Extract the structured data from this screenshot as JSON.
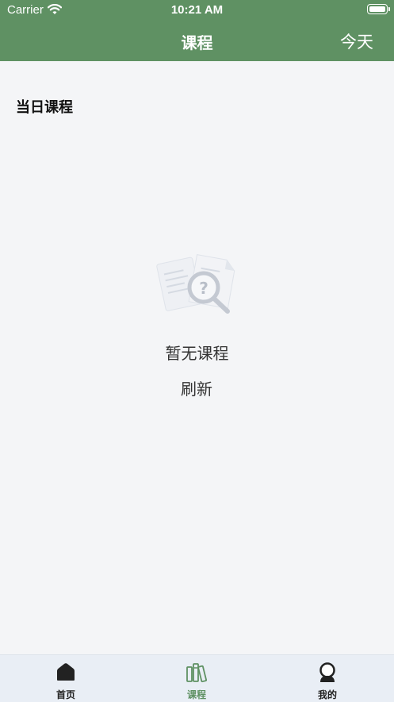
{
  "status_bar": {
    "carrier": "Carrier",
    "time": "10:21 AM"
  },
  "nav": {
    "title": "课程",
    "right_action": "今天"
  },
  "content": {
    "section_title": "当日课程",
    "empty_message": "暂无课程",
    "refresh_label": "刷新"
  },
  "tabbar": {
    "items": [
      {
        "label": "首页",
        "icon": "home-icon"
      },
      {
        "label": "课程",
        "icon": "books-icon"
      },
      {
        "label": "我的",
        "icon": "profile-icon"
      }
    ],
    "active_index": 1
  },
  "colors": {
    "header": "#5f9163",
    "background": "#f4f5f7",
    "tabbar": "#e9eef5",
    "active_tab": "#5f9163"
  }
}
